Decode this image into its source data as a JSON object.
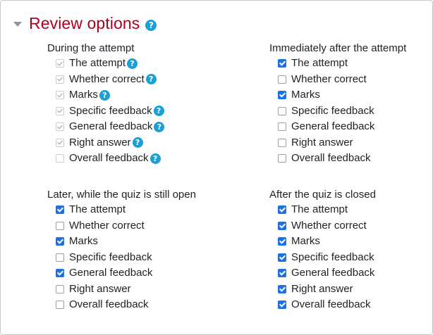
{
  "section": {
    "title": "Review options",
    "help_icon": "question-circle-icon"
  },
  "groups": {
    "during": {
      "label": "During the attempt",
      "options": [
        {
          "label": "The attempt",
          "checked": true,
          "disabled": true,
          "help": true
        },
        {
          "label": "Whether correct",
          "checked": true,
          "disabled": true,
          "help": true
        },
        {
          "label": "Marks",
          "checked": true,
          "disabled": true,
          "help": true
        },
        {
          "label": "Specific feedback",
          "checked": true,
          "disabled": true,
          "help": true
        },
        {
          "label": "General feedback",
          "checked": true,
          "disabled": true,
          "help": true
        },
        {
          "label": "Right answer",
          "checked": true,
          "disabled": true,
          "help": true
        },
        {
          "label": "Overall feedback",
          "checked": false,
          "disabled": true,
          "help": true
        }
      ]
    },
    "immediately": {
      "label": "Immediately after the attempt",
      "options": [
        {
          "label": "The attempt",
          "checked": true,
          "disabled": false,
          "help": false
        },
        {
          "label": "Whether correct",
          "checked": false,
          "disabled": false,
          "help": false
        },
        {
          "label": "Marks",
          "checked": true,
          "disabled": false,
          "help": false
        },
        {
          "label": "Specific feedback",
          "checked": false,
          "disabled": false,
          "help": false
        },
        {
          "label": "General feedback",
          "checked": false,
          "disabled": false,
          "help": false
        },
        {
          "label": "Right answer",
          "checked": false,
          "disabled": false,
          "help": false
        },
        {
          "label": "Overall feedback",
          "checked": false,
          "disabled": false,
          "help": false
        }
      ]
    },
    "later": {
      "label": "Later, while the quiz is still open",
      "options": [
        {
          "label": "The attempt",
          "checked": true,
          "disabled": false,
          "help": false
        },
        {
          "label": "Whether correct",
          "checked": false,
          "disabled": false,
          "help": false
        },
        {
          "label": "Marks",
          "checked": true,
          "disabled": false,
          "help": false
        },
        {
          "label": "Specific feedback",
          "checked": false,
          "disabled": false,
          "help": false
        },
        {
          "label": "General feedback",
          "checked": true,
          "disabled": false,
          "help": false
        },
        {
          "label": "Right answer",
          "checked": false,
          "disabled": false,
          "help": false
        },
        {
          "label": "Overall feedback",
          "checked": false,
          "disabled": false,
          "help": false
        }
      ]
    },
    "closed": {
      "label": "After the quiz is closed",
      "options": [
        {
          "label": "The attempt",
          "checked": true,
          "disabled": false,
          "help": false
        },
        {
          "label": "Whether correct",
          "checked": true,
          "disabled": false,
          "help": false
        },
        {
          "label": "Marks",
          "checked": true,
          "disabled": false,
          "help": false
        },
        {
          "label": "Specific feedback",
          "checked": true,
          "disabled": false,
          "help": false
        },
        {
          "label": "General feedback",
          "checked": true,
          "disabled": false,
          "help": false
        },
        {
          "label": "Right answer",
          "checked": true,
          "disabled": false,
          "help": false
        },
        {
          "label": "Overall feedback",
          "checked": true,
          "disabled": false,
          "help": false
        }
      ]
    }
  },
  "colors": {
    "title": "#b00020",
    "checkbox_checked": "#1f6fe5",
    "help_icon": "#1aa0d6"
  }
}
